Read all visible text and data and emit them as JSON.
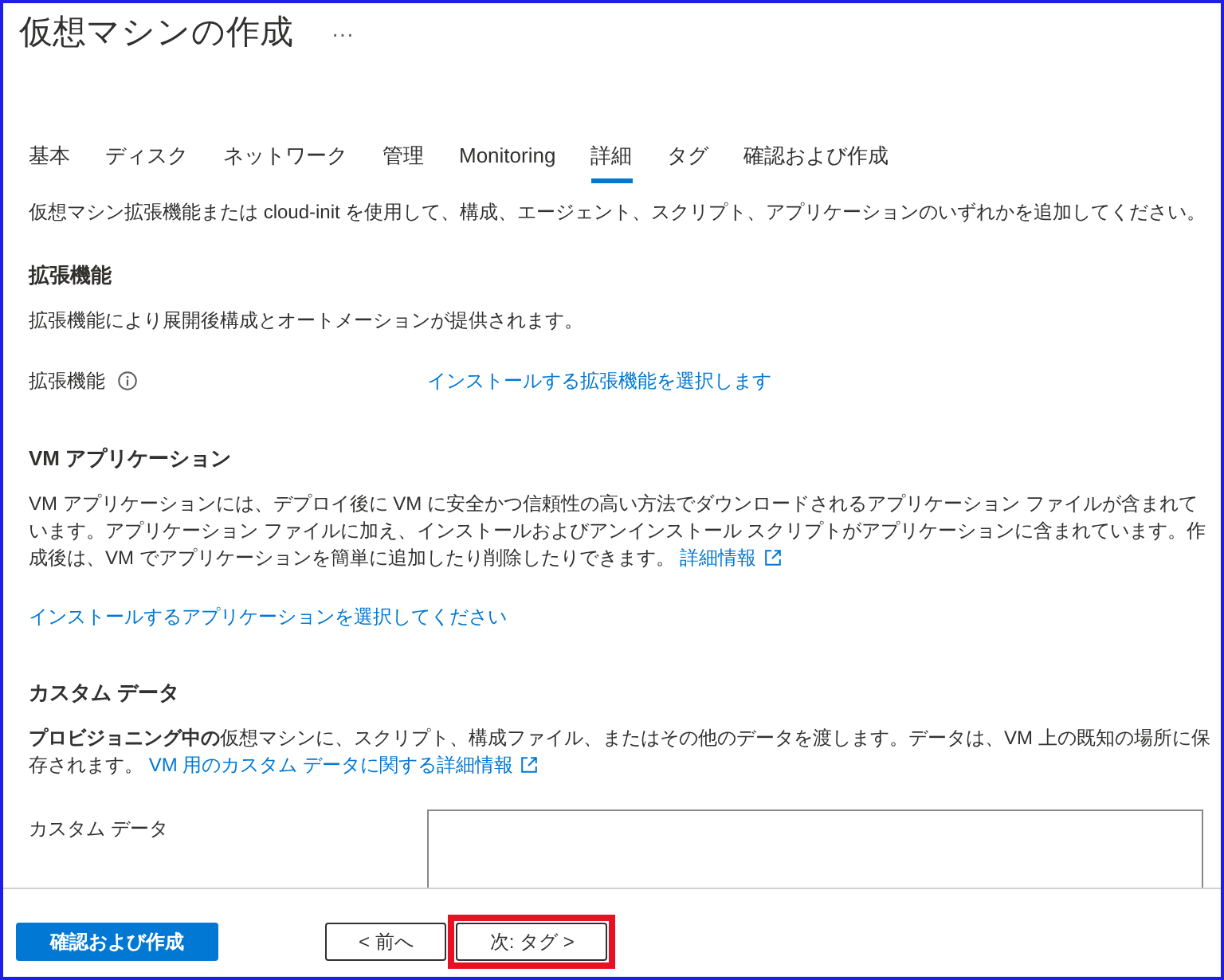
{
  "window": {
    "title": "仮想マシンの作成",
    "more_menu": "···"
  },
  "tabs": [
    {
      "label": "基本",
      "selected": false
    },
    {
      "label": "ディスク",
      "selected": false
    },
    {
      "label": "ネットワーク",
      "selected": false
    },
    {
      "label": "管理",
      "selected": false
    },
    {
      "label": "Monitoring",
      "selected": false
    },
    {
      "label": "詳細",
      "selected": true
    },
    {
      "label": "タグ",
      "selected": false
    },
    {
      "label": "確認および作成",
      "selected": false
    }
  ],
  "intro": "仮想マシン拡張機能または cloud-init を使用して、構成、エージェント、スクリプト、アプリケーションのいずれかを追加してください。",
  "sections": [
    {
      "heading": "拡張機能",
      "items": [
        {
          "kind": "paragraph",
          "text": "拡張機能により展開後構成とオートメーションが提供されます。"
        },
        {
          "kind": "link_field",
          "label": "拡張機能",
          "info": true,
          "value": "インストールする拡張機能を選択します"
        }
      ]
    },
    {
      "heading": "VM アプリケーション",
      "items": [
        {
          "kind": "paragraph",
          "text": "VM アプリケーションには、デプロイ後に VM に安全かつ信頼性の高い方法でダウンロードされるアプリケーション ファイルが含まれています。アプリケーション ファイルに加え、インストールおよびアンインストール スクリプトがアプリケーションに含まれています。作成後は、VM でアプリケーションを簡単に追加したり削除したりできます。",
          "link": "詳細情報",
          "external": true
        },
        {
          "kind": "link",
          "text": "インストールするアプリケーションを選択してください"
        }
      ]
    },
    {
      "heading": "カスタム データ",
      "items": [
        {
          "kind": "paragraph",
          "text": "**プロビジョニング中の**仮想マシンに、スクリプト、構成ファイル、またはその他のデータを渡します。データは、VM 上の既知の場所に保存されます。",
          "link": "VM 用のカスタム データに関する詳細情報",
          "external": true
        },
        {
          "kind": "textarea_field",
          "label": "カスタム データ"
        }
      ]
    }
  ],
  "footer_buttons": [
    {
      "label": "確認および作成",
      "kind": "primary",
      "highlighted": false
    },
    {
      "label": "< 前へ",
      "kind": "secondary",
      "highlighted": false
    },
    {
      "label": "次: タグ >",
      "kind": "secondary",
      "highlighted": true
    }
  ]
}
